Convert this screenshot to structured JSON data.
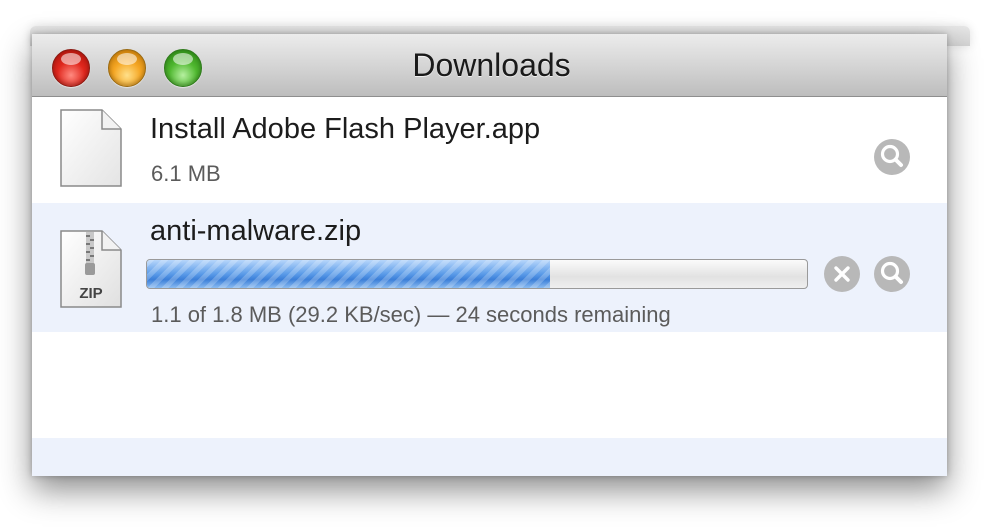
{
  "window": {
    "title": "Downloads"
  },
  "downloads": [
    {
      "name": "Install Adobe Flash Player.app",
      "size": "6.1 MB",
      "icon": "generic-document-icon"
    },
    {
      "name": "anti-malware.zip",
      "status": "1.1 of 1.8 MB (29.2 KB/sec) — 24 seconds remaining",
      "progress": 0.61,
      "icon": "zip-archive-icon",
      "icon_label": "ZIP"
    }
  ],
  "colors": {
    "selected_row": "#edf2fc",
    "progress_fill": "#4a8de0",
    "button_gray": "#b8b8b8"
  }
}
